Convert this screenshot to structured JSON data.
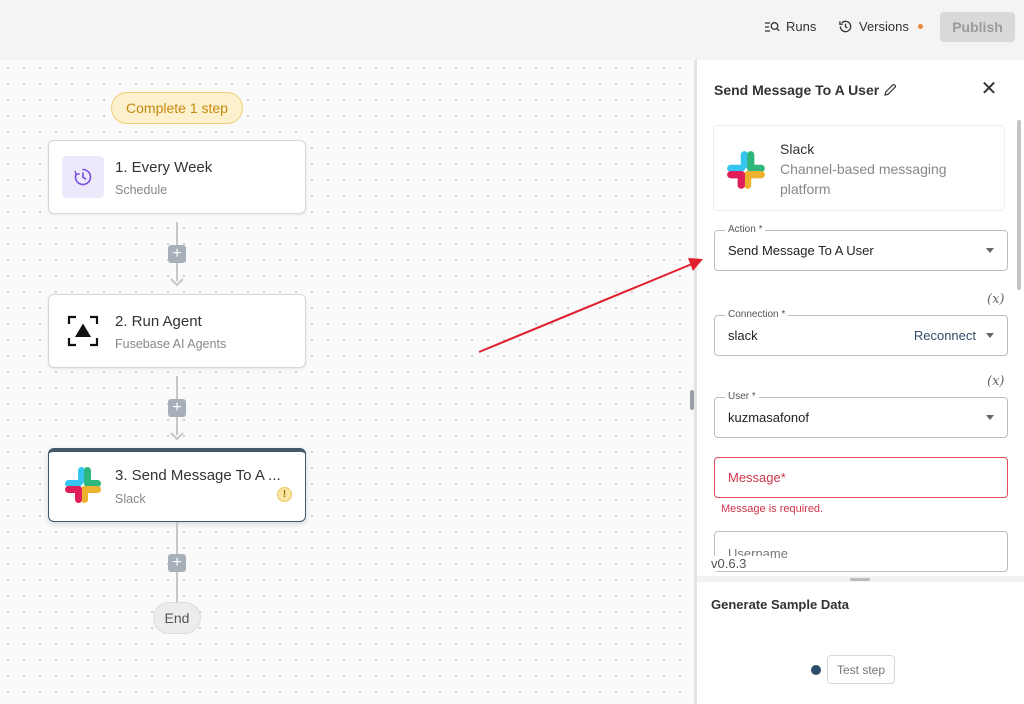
{
  "topbar": {
    "runs_label": "Runs",
    "versions_label": "Versions",
    "publish_label": "Publish"
  },
  "canvas": {
    "status_pill": "Complete 1 step",
    "nodes": [
      {
        "title": "1. Every Week",
        "subtitle": "Schedule",
        "icon": "schedule-clock-icon"
      },
      {
        "title": "2. Run Agent",
        "subtitle": "Fusebase AI Agents",
        "icon": "fusebase-agent-icon"
      },
      {
        "title": "3. Send Message To A ...",
        "subtitle": "Slack",
        "icon": "slack-logo-icon",
        "warning": "!"
      }
    ],
    "end_label": "End"
  },
  "panel": {
    "title": "Send Message To A User",
    "app": {
      "name": "Slack",
      "description": "Channel-based messaging platform"
    },
    "action": {
      "label": "Action *",
      "value": "Send Message To A User"
    },
    "connection": {
      "label": "Connection *",
      "value": "slack",
      "reconnect": "Reconnect"
    },
    "user": {
      "label": "User *",
      "value": "kuzmasafonof"
    },
    "message": {
      "placeholder": "Message*",
      "error": "Message is required."
    },
    "username": {
      "placeholder": "Username"
    },
    "fx_label": "(x)",
    "version": "v0.6.3"
  },
  "sample": {
    "title": "Generate Sample Data",
    "test_label": "Test step"
  },
  "colors": {
    "accent": "#2f4e6b",
    "error": "#d0354a",
    "annotation_arrow": "#e0202e"
  }
}
